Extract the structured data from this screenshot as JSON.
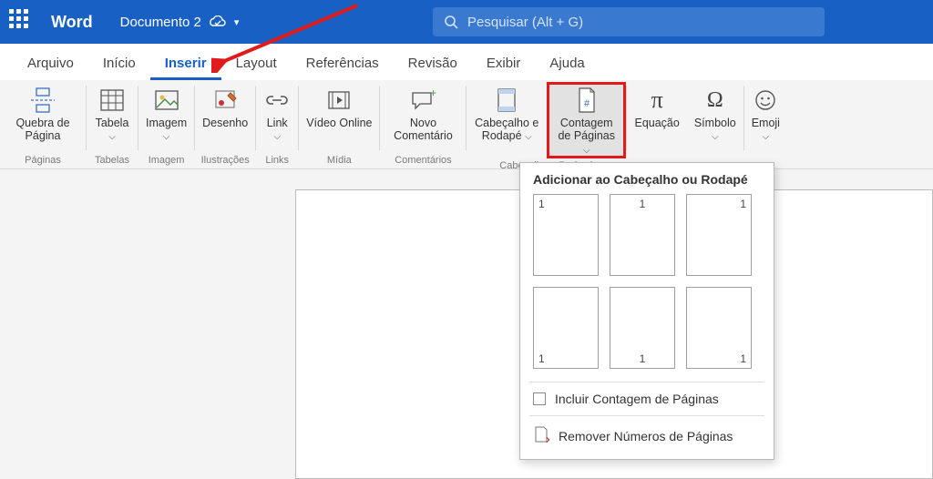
{
  "titlebar": {
    "app_name": "Word",
    "doc_name": "Documento 2",
    "search_placeholder": "Pesquisar (Alt + G)"
  },
  "tabs": {
    "arquivo": "Arquivo",
    "inicio": "Início",
    "inserir": "Inserir",
    "layout": "Layout",
    "referencias": "Referências",
    "revisao": "Revisão",
    "exibir": "Exibir",
    "ajuda": "Ajuda",
    "active": "inserir"
  },
  "ribbon": {
    "groups": {
      "paginas": "Páginas",
      "tabelas": "Tabelas",
      "imagem": "Imagem",
      "ilustracoes": "Ilustrações",
      "links": "Links",
      "midia": "Mídia",
      "comentarios": "Comentários",
      "cabecalho": "Cabeçalho e Rodapé"
    },
    "items": {
      "quebra": "Quebra de Página",
      "tabela": "Tabela",
      "imagem": "Imagem",
      "desenho": "Desenho",
      "link": "Link",
      "video": "Vídeo Online",
      "comentario": "Novo Comentário",
      "cabecalho_rodape": "Cabeçalho e Rodapé",
      "contagem": "Contagem de Páginas",
      "equacao": "Equação",
      "simbolo": "Símbolo",
      "emoji": "Emoji"
    }
  },
  "dropdown": {
    "header": "Adicionar ao Cabeçalho ou Rodapé",
    "thumb_number": "1",
    "include_count": "Incluir Contagem de Páginas",
    "remove": "Remover Números de Páginas"
  }
}
